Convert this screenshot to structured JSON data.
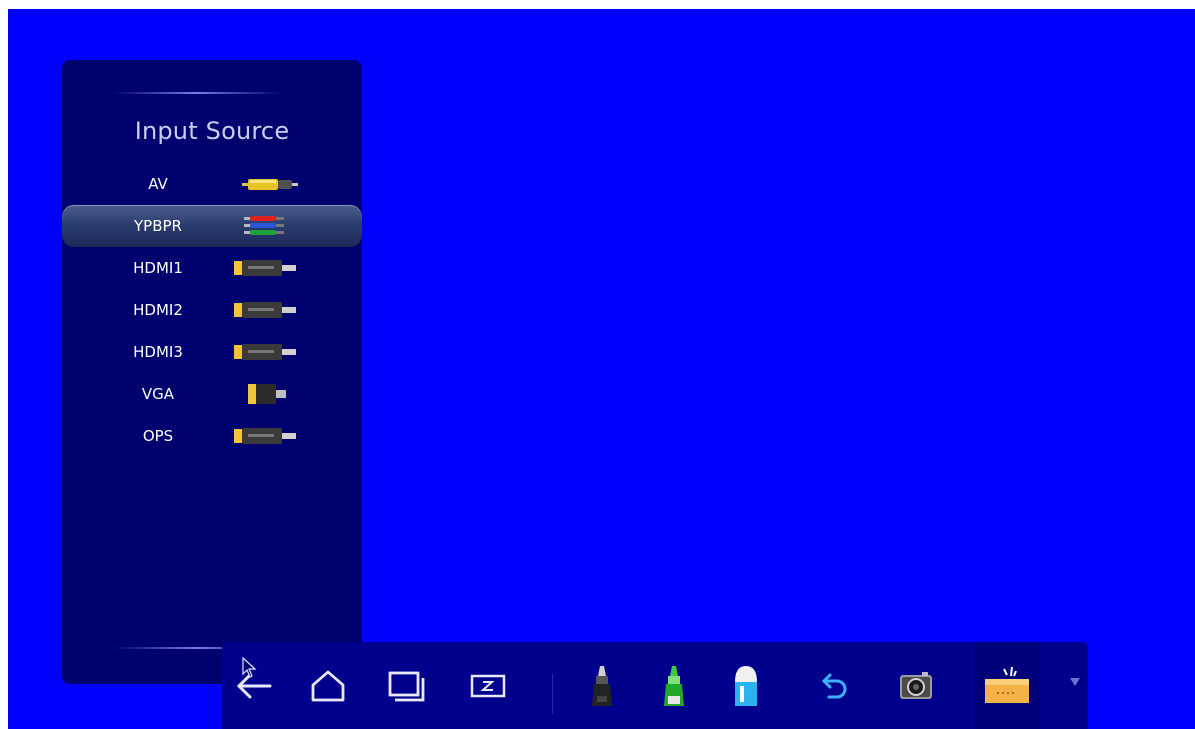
{
  "panel": {
    "title": "Input Source",
    "items": [
      {
        "label": "AV",
        "connector": "rca-yellow-icon",
        "selected": false
      },
      {
        "label": "YPBPR",
        "connector": "component-rgb-icon",
        "selected": true
      },
      {
        "label": "HDMI1",
        "connector": "hdmi-icon",
        "selected": false
      },
      {
        "label": "HDMI2",
        "connector": "hdmi-icon",
        "selected": false
      },
      {
        "label": "HDMI3",
        "connector": "hdmi-icon",
        "selected": false
      },
      {
        "label": "VGA",
        "connector": "vga-icon",
        "selected": false
      },
      {
        "label": "OPS",
        "connector": "hdmi-icon",
        "selected": false
      }
    ]
  },
  "taskbar": {
    "buttons": [
      {
        "name": "back",
        "icon": "back-arrow-icon"
      },
      {
        "name": "home",
        "icon": "home-icon"
      },
      {
        "name": "recent-apps",
        "icon": "recent-apps-icon"
      },
      {
        "name": "whiteboard",
        "icon": "z-icon"
      },
      {
        "name": "black-marker",
        "icon": "black-marker-icon"
      },
      {
        "name": "green-marker",
        "icon": "green-marker-icon"
      },
      {
        "name": "eraser",
        "icon": "eraser-icon"
      },
      {
        "name": "undo",
        "icon": "undo-icon"
      },
      {
        "name": "screenshot",
        "icon": "camera-icon"
      },
      {
        "name": "toolbox",
        "icon": "toolbox-icon"
      }
    ]
  },
  "colors": {
    "background": "#0000ff",
    "panel": "#00006e",
    "taskbar": "#00008c"
  }
}
